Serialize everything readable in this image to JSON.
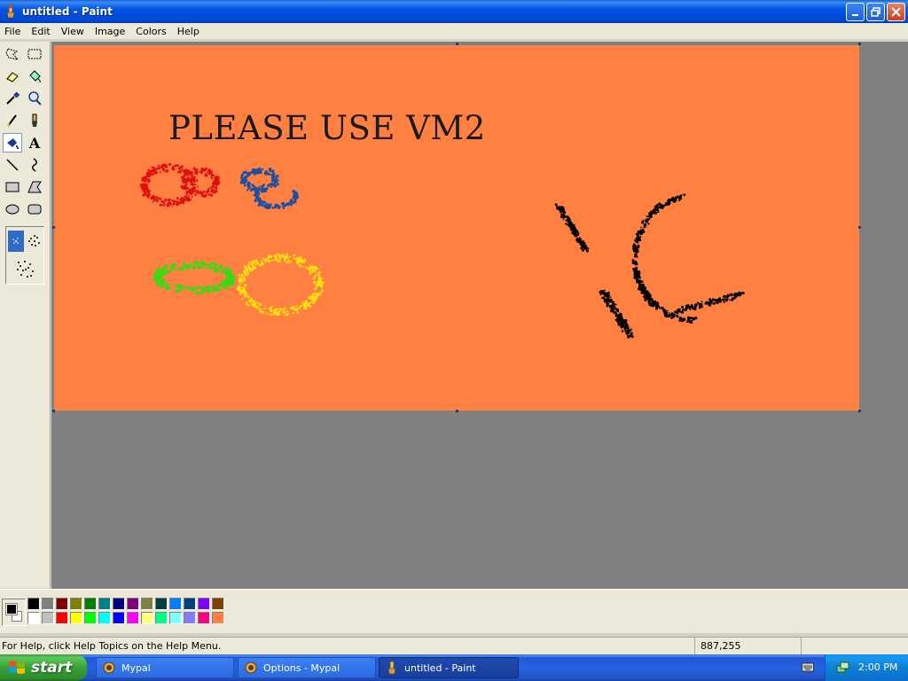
{
  "window": {
    "title": "untitled - Paint"
  },
  "menu": {
    "items": [
      "File",
      "Edit",
      "View",
      "Image",
      "Colors",
      "Help"
    ]
  },
  "tools": [
    {
      "name": "free-form-select-icon"
    },
    {
      "name": "select-icon"
    },
    {
      "name": "eraser-icon"
    },
    {
      "name": "fill-bucket-icon"
    },
    {
      "name": "pick-color-icon"
    },
    {
      "name": "magnifier-icon"
    },
    {
      "name": "pencil-icon"
    },
    {
      "name": "brush-icon"
    },
    {
      "name": "airbrush-icon",
      "active": true
    },
    {
      "name": "text-icon",
      "glyph": "A"
    },
    {
      "name": "line-icon"
    },
    {
      "name": "curve-icon"
    },
    {
      "name": "rectangle-icon"
    },
    {
      "name": "polygon-icon"
    },
    {
      "name": "ellipse-icon"
    },
    {
      "name": "rounded-rectangle-icon"
    }
  ],
  "canvas": {
    "text": "PLEASE USE VM2",
    "background_color": "#ff8040"
  },
  "palette": {
    "foreground": "#000000",
    "background": "#ffffff",
    "colors_top": [
      "#000000",
      "#808080",
      "#800000",
      "#808000",
      "#008000",
      "#008080",
      "#000080",
      "#800080",
      "#808040",
      "#004040",
      "#0080ff",
      "#004080",
      "#8000ff",
      "#804000"
    ],
    "colors_bottom": [
      "#ffffff",
      "#c0c0c0",
      "#ff0000",
      "#ffff00",
      "#00ff00",
      "#00ffff",
      "#0000ff",
      "#ff00ff",
      "#ffff80",
      "#00ff80",
      "#80ffff",
      "#8080ff",
      "#ff0080",
      "#ff8040"
    ]
  },
  "status": {
    "help_text": "For Help, click Help Topics on the Help Menu.",
    "coords": "887,255"
  },
  "taskbar": {
    "start_label": "start",
    "tasks": [
      {
        "label": "Mypal"
      },
      {
        "label": "Options - Mypal"
      },
      {
        "label": "untitled - Paint",
        "active": true
      }
    ],
    "clock": "2:00 PM"
  }
}
